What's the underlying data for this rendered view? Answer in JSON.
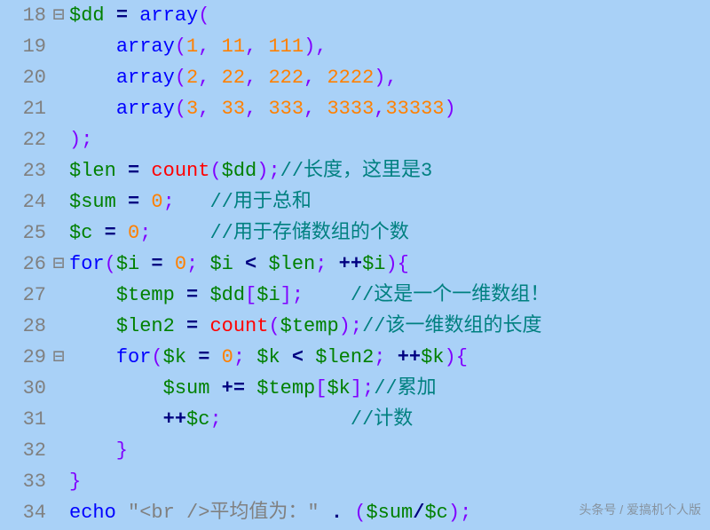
{
  "lineNumbers": [
    "18",
    "19",
    "20",
    "21",
    "22",
    "23",
    "24",
    "25",
    "26",
    "27",
    "28",
    "29",
    "30",
    "31",
    "32",
    "33",
    "34"
  ],
  "foldMarkers": [
    "⊟",
    "",
    "",
    "",
    "",
    "",
    "",
    "",
    "⊟",
    "",
    "",
    "⊟",
    "",
    "",
    "",
    "",
    ""
  ],
  "tokens": {
    "l18": [
      [
        "var",
        "$dd"
      ],
      [
        "pn",
        " "
      ],
      [
        "op",
        "="
      ],
      [
        "pn",
        " "
      ],
      [
        "kw",
        "array"
      ],
      [
        "pn",
        "("
      ]
    ],
    "l19": [
      [
        "pn",
        "    "
      ],
      [
        "kw",
        "array"
      ],
      [
        "pn",
        "("
      ],
      [
        "num",
        "1"
      ],
      [
        "pn",
        ", "
      ],
      [
        "num",
        "11"
      ],
      [
        "pn",
        ", "
      ],
      [
        "num",
        "111"
      ],
      [
        "pn",
        "),"
      ]
    ],
    "l20": [
      [
        "pn",
        "    "
      ],
      [
        "kw",
        "array"
      ],
      [
        "pn",
        "("
      ],
      [
        "num",
        "2"
      ],
      [
        "pn",
        ", "
      ],
      [
        "num",
        "22"
      ],
      [
        "pn",
        ", "
      ],
      [
        "num",
        "222"
      ],
      [
        "pn",
        ", "
      ],
      [
        "num",
        "2222"
      ],
      [
        "pn",
        "),"
      ]
    ],
    "l21": [
      [
        "pn",
        "    "
      ],
      [
        "kw",
        "array"
      ],
      [
        "pn",
        "("
      ],
      [
        "num",
        "3"
      ],
      [
        "pn",
        ", "
      ],
      [
        "num",
        "33"
      ],
      [
        "pn",
        ", "
      ],
      [
        "num",
        "333"
      ],
      [
        "pn",
        ", "
      ],
      [
        "num",
        "3333"
      ],
      [
        "pn",
        ","
      ],
      [
        "num",
        "33333"
      ],
      [
        "pn",
        ")"
      ]
    ],
    "l22": [
      [
        "pn",
        ");"
      ]
    ],
    "l23": [
      [
        "var",
        "$len"
      ],
      [
        "pn",
        " "
      ],
      [
        "op",
        "="
      ],
      [
        "pn",
        " "
      ],
      [
        "fn",
        "count"
      ],
      [
        "pn",
        "("
      ],
      [
        "var",
        "$dd"
      ],
      [
        "pn",
        ");"
      ],
      [
        "cm",
        "//长度，这里是3"
      ]
    ],
    "l24": [
      [
        "var",
        "$sum"
      ],
      [
        "pn",
        " "
      ],
      [
        "op",
        "="
      ],
      [
        "pn",
        " "
      ],
      [
        "num",
        "0"
      ],
      [
        "pn",
        ";   "
      ],
      [
        "cm",
        "//用于总和"
      ]
    ],
    "l25": [
      [
        "var",
        "$c"
      ],
      [
        "pn",
        " "
      ],
      [
        "op",
        "="
      ],
      [
        "pn",
        " "
      ],
      [
        "num",
        "0"
      ],
      [
        "pn",
        ";     "
      ],
      [
        "cm",
        "//用于存储数组的个数"
      ]
    ],
    "l26": [
      [
        "kw",
        "for"
      ],
      [
        "pn",
        "("
      ],
      [
        "var",
        "$i"
      ],
      [
        "pn",
        " "
      ],
      [
        "op",
        "="
      ],
      [
        "pn",
        " "
      ],
      [
        "num",
        "0"
      ],
      [
        "pn",
        "; "
      ],
      [
        "var",
        "$i"
      ],
      [
        "pn",
        " "
      ],
      [
        "op",
        "<"
      ],
      [
        "pn",
        " "
      ],
      [
        "var",
        "$len"
      ],
      [
        "pn",
        "; "
      ],
      [
        "op",
        "++"
      ],
      [
        "var",
        "$i"
      ],
      [
        "pn",
        "){"
      ]
    ],
    "l27": [
      [
        "pn",
        "    "
      ],
      [
        "var",
        "$temp"
      ],
      [
        "pn",
        " "
      ],
      [
        "op",
        "="
      ],
      [
        "pn",
        " "
      ],
      [
        "var",
        "$dd"
      ],
      [
        "pn",
        "["
      ],
      [
        "var",
        "$i"
      ],
      [
        "pn",
        "];    "
      ],
      [
        "cm",
        "//这是一个一维数组！"
      ]
    ],
    "l28": [
      [
        "pn",
        "    "
      ],
      [
        "var",
        "$len2"
      ],
      [
        "pn",
        " "
      ],
      [
        "op",
        "="
      ],
      [
        "pn",
        " "
      ],
      [
        "fn",
        "count"
      ],
      [
        "pn",
        "("
      ],
      [
        "var",
        "$temp"
      ],
      [
        "pn",
        ");"
      ],
      [
        "cm",
        "//该一维数组的长度"
      ]
    ],
    "l29": [
      [
        "pn",
        "    "
      ],
      [
        "kw",
        "for"
      ],
      [
        "pn",
        "("
      ],
      [
        "var",
        "$k"
      ],
      [
        "pn",
        " "
      ],
      [
        "op",
        "="
      ],
      [
        "pn",
        " "
      ],
      [
        "num",
        "0"
      ],
      [
        "pn",
        "; "
      ],
      [
        "var",
        "$k"
      ],
      [
        "pn",
        " "
      ],
      [
        "op",
        "<"
      ],
      [
        "pn",
        " "
      ],
      [
        "var",
        "$len2"
      ],
      [
        "pn",
        "; "
      ],
      [
        "op",
        "++"
      ],
      [
        "var",
        "$k"
      ],
      [
        "pn",
        "){"
      ]
    ],
    "l30": [
      [
        "pn",
        "        "
      ],
      [
        "var",
        "$sum"
      ],
      [
        "pn",
        " "
      ],
      [
        "op",
        "+="
      ],
      [
        "pn",
        " "
      ],
      [
        "var",
        "$temp"
      ],
      [
        "pn",
        "["
      ],
      [
        "var",
        "$k"
      ],
      [
        "pn",
        "];"
      ],
      [
        "cm",
        "//累加"
      ]
    ],
    "l31": [
      [
        "pn",
        "        "
      ],
      [
        "op",
        "++"
      ],
      [
        "var",
        "$c"
      ],
      [
        "pn",
        ";           "
      ],
      [
        "cm",
        "//计数"
      ]
    ],
    "l32": [
      [
        "pn",
        "    }"
      ]
    ],
    "l33": [
      [
        "pn",
        "}"
      ]
    ],
    "l34": [
      [
        "kw",
        "echo"
      ],
      [
        "pn",
        " "
      ],
      [
        "str",
        "\"<br />平均值为：\""
      ],
      [
        "pn",
        " "
      ],
      [
        "op",
        "."
      ],
      [
        "pn",
        " ("
      ],
      [
        "var",
        "$sum"
      ],
      [
        "op",
        "/"
      ],
      [
        "var",
        "$c"
      ],
      [
        "pn",
        ");"
      ]
    ]
  },
  "watermark": "头条号 / 爱搞机个人版"
}
